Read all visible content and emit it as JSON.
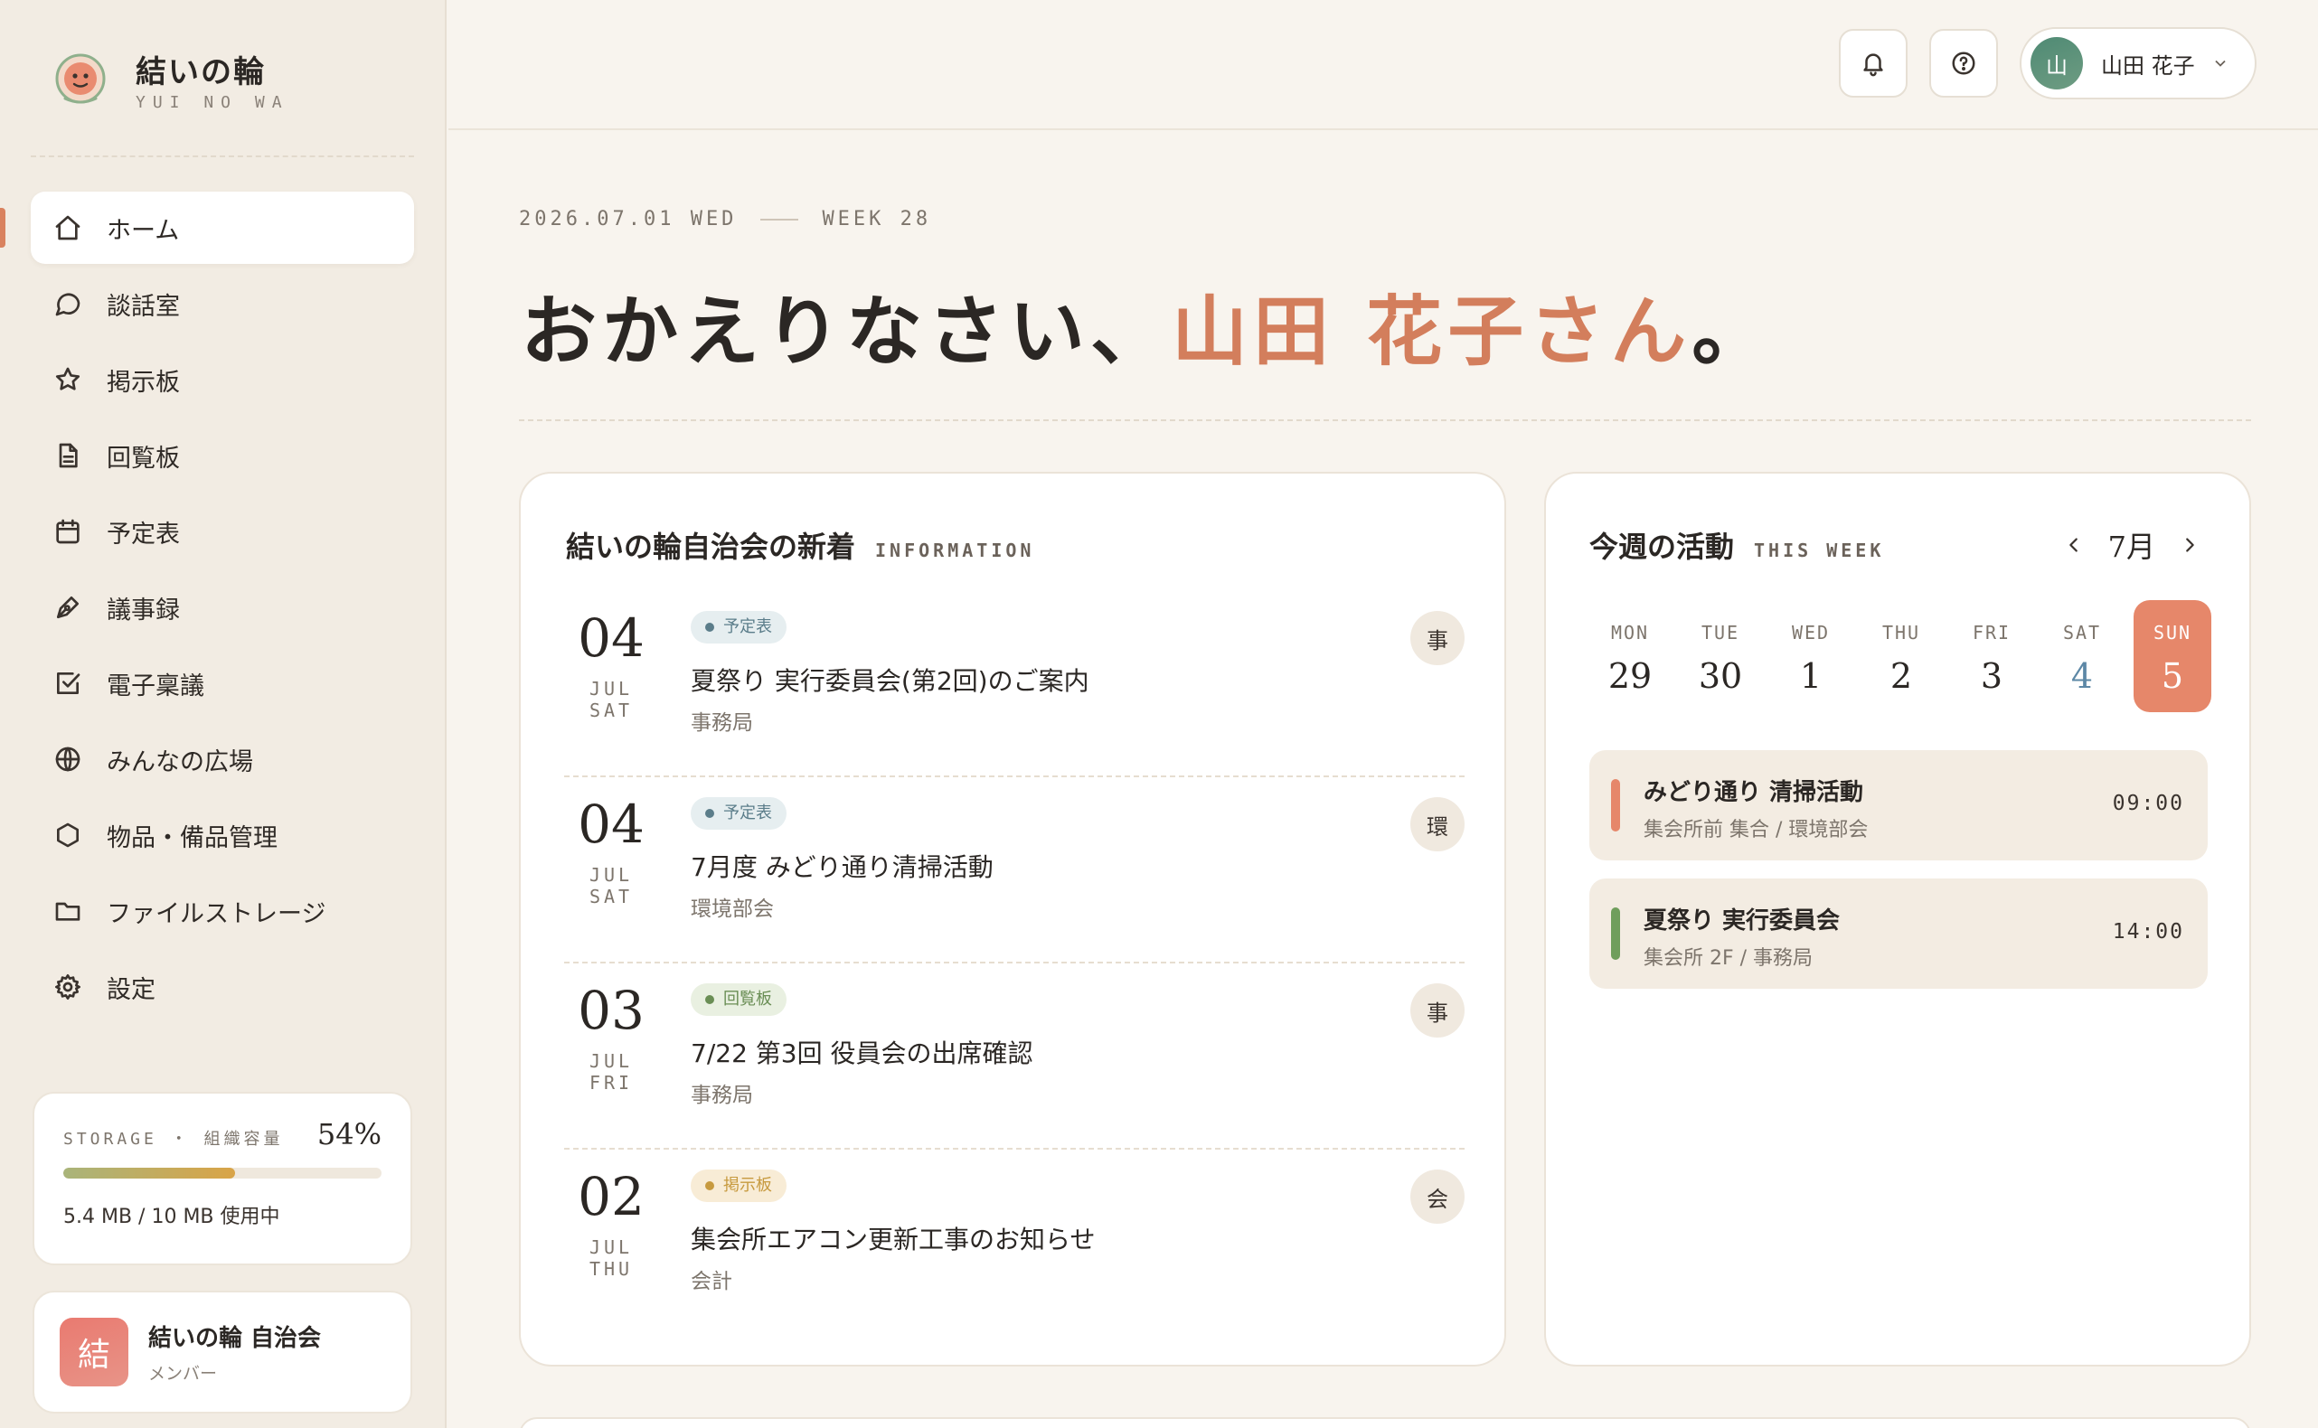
{
  "brand": {
    "name": "結いの輪",
    "sub": "YUI NO WA"
  },
  "nav": [
    {
      "label": "ホーム",
      "icon": "home-icon"
    },
    {
      "label": "談話室",
      "icon": "chat-icon"
    },
    {
      "label": "掲示板",
      "icon": "star-icon"
    },
    {
      "label": "回覧板",
      "icon": "document-icon"
    },
    {
      "label": "予定表",
      "icon": "calendar-icon"
    },
    {
      "label": "議事録",
      "icon": "pen-icon"
    },
    {
      "label": "電子稟議",
      "icon": "checkbox-icon"
    },
    {
      "label": "みんなの広場",
      "icon": "globe-icon"
    },
    {
      "label": "物品・備品管理",
      "icon": "hexagon-icon"
    },
    {
      "label": "ファイルストレージ",
      "icon": "folder-icon"
    },
    {
      "label": "設定",
      "icon": "gear-icon"
    }
  ],
  "storage": {
    "label": "STORAGE ・ 組織容量",
    "percent_label": "54%",
    "fill_fraction": 0.54,
    "usage": "5.4 MB / 10 MB 使用中"
  },
  "org": {
    "avatar": "結",
    "name": "結いの輪 自治会",
    "role": "メンバー"
  },
  "topbar": {
    "notification_icon": "bell-icon",
    "help_icon": "help-icon",
    "user": {
      "avatar": "山",
      "name": "山田 花子"
    }
  },
  "hero": {
    "date": "2026.07.01 WED",
    "week": "WEEK 28",
    "greeting_prefix": "おかえりなさい、",
    "greeting_name": "山田 花子さん",
    "greeting_suffix": "。"
  },
  "news": {
    "title": "結いの輪自治会の新着",
    "title_en": "INFORMATION",
    "items": [
      {
        "day": "04",
        "monthday": "JUL SAT",
        "tag": "予定表",
        "tag_color": "#5b7d8a",
        "title": "夏祭り 実行委員会(第2回)のご案内",
        "dept": "事務局",
        "badge": "事"
      },
      {
        "day": "04",
        "monthday": "JUL SAT",
        "tag": "予定表",
        "tag_color": "#5b7d8a",
        "title": "7月度 みどり通り清掃活動",
        "dept": "環境部会",
        "badge": "環"
      },
      {
        "day": "03",
        "monthday": "JUL FRI",
        "tag": "回覧板",
        "tag_color": "#6a8e55",
        "title": "7/22 第3回 役員会の出席確認",
        "dept": "事務局",
        "badge": "事"
      },
      {
        "day": "02",
        "monthday": "JUL THU",
        "tag": "掲示板",
        "tag_color": "#c79a3f",
        "title": "集会所エアコン更新工事のお知らせ",
        "dept": "会計",
        "badge": "会"
      }
    ]
  },
  "week": {
    "title": "今週の活動",
    "title_en": "THIS WEEK",
    "month": "7月",
    "days": [
      {
        "name": "MON",
        "num": "29"
      },
      {
        "name": "TUE",
        "num": "30"
      },
      {
        "name": "WED",
        "num": "1"
      },
      {
        "name": "THU",
        "num": "2"
      },
      {
        "name": "FRI",
        "num": "3"
      },
      {
        "name": "SAT",
        "num": "4"
      },
      {
        "name": "SUN",
        "num": "5"
      }
    ],
    "today_index": 6,
    "events": [
      {
        "title": "みどり通り 清掃活動",
        "sub": "集会所前 集合 / 環境部会",
        "time": "09:00",
        "color": "#e6876a"
      },
      {
        "title": "夏祭り 実行委員会",
        "sub": "集会所 2F / 事務局",
        "time": "14:00",
        "color": "#6f9e5c"
      }
    ]
  }
}
